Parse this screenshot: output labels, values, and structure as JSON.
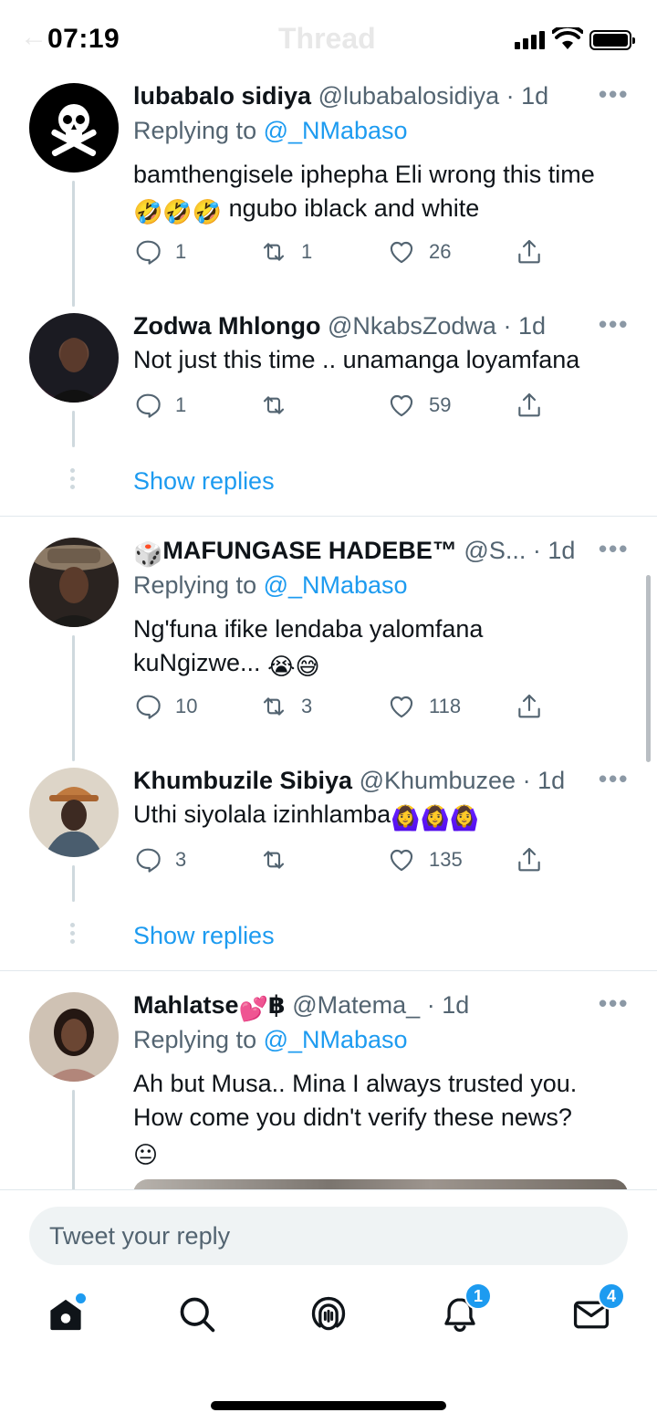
{
  "status_bar": {
    "time": "07:19",
    "title": "Thread"
  },
  "tweets": [
    {
      "name": "lubabalo sidiya",
      "handle": "@lubabalosidiya",
      "time": "· 1d",
      "replying_prefix": "Replying to ",
      "replying_to": "@_NMabaso",
      "text_line1": "bamthengisele iphepha Eli wrong this time",
      "text_line2_emoji": "🤣🤣🤣",
      "text_line2": " ngubo iblack and white",
      "counts": {
        "replies": "1",
        "retweets": "1",
        "likes": "26"
      }
    },
    {
      "name": "Zodwa Mhlongo",
      "handle": "@NkabsZodwa",
      "time": "· 1d",
      "text": "Not just this time .. unamanga loyamfana",
      "counts": {
        "replies": "1",
        "retweets": "",
        "likes": "59"
      }
    },
    {
      "name_emoji": "🎲",
      "name": "MAFUNGASE HADEBE™",
      "handle": "@S...",
      "time": "· 1d",
      "replying_prefix": "Replying to ",
      "replying_to": "@_NMabaso",
      "text_line1": "Ng'funa ifike lendaba yalomfana",
      "text_line2": "kuNgizwe... ",
      "text_line2_emoji": "😭😅",
      "counts": {
        "replies": "10",
        "retweets": "3",
        "likes": "118"
      }
    },
    {
      "name": "Khumbuzile Sibiya",
      "handle": "@Khumbuzee",
      "time": "· 1d",
      "text": "Uthi siyolala izinhlamba",
      "text_emoji": "🙆‍♀️🙆‍♀️🙆‍♀️",
      "counts": {
        "replies": "3",
        "retweets": "",
        "likes": "135"
      }
    },
    {
      "name": "Mahlatse",
      "name_emoji": "💕",
      "name_suffix": "฿",
      "handle": "@Matema_",
      "time": "· 1d",
      "replying_prefix": "Replying to ",
      "replying_to": "@_NMabaso",
      "text_line1": "Ah but Musa.. Mina I always trusted you.",
      "text_line2": "How come you didn't verify these news?",
      "text_line3_emoji": "😐"
    }
  ],
  "show_replies_label": "Show replies",
  "more_glyph": "•••",
  "reply_box": {
    "placeholder": "Tweet your reply"
  },
  "tabbar": {
    "notifications_badge": "1",
    "messages_badge": "4"
  },
  "colors": {
    "accent": "#1d9bf0",
    "text": "#0f1419",
    "secondary": "#536471"
  }
}
